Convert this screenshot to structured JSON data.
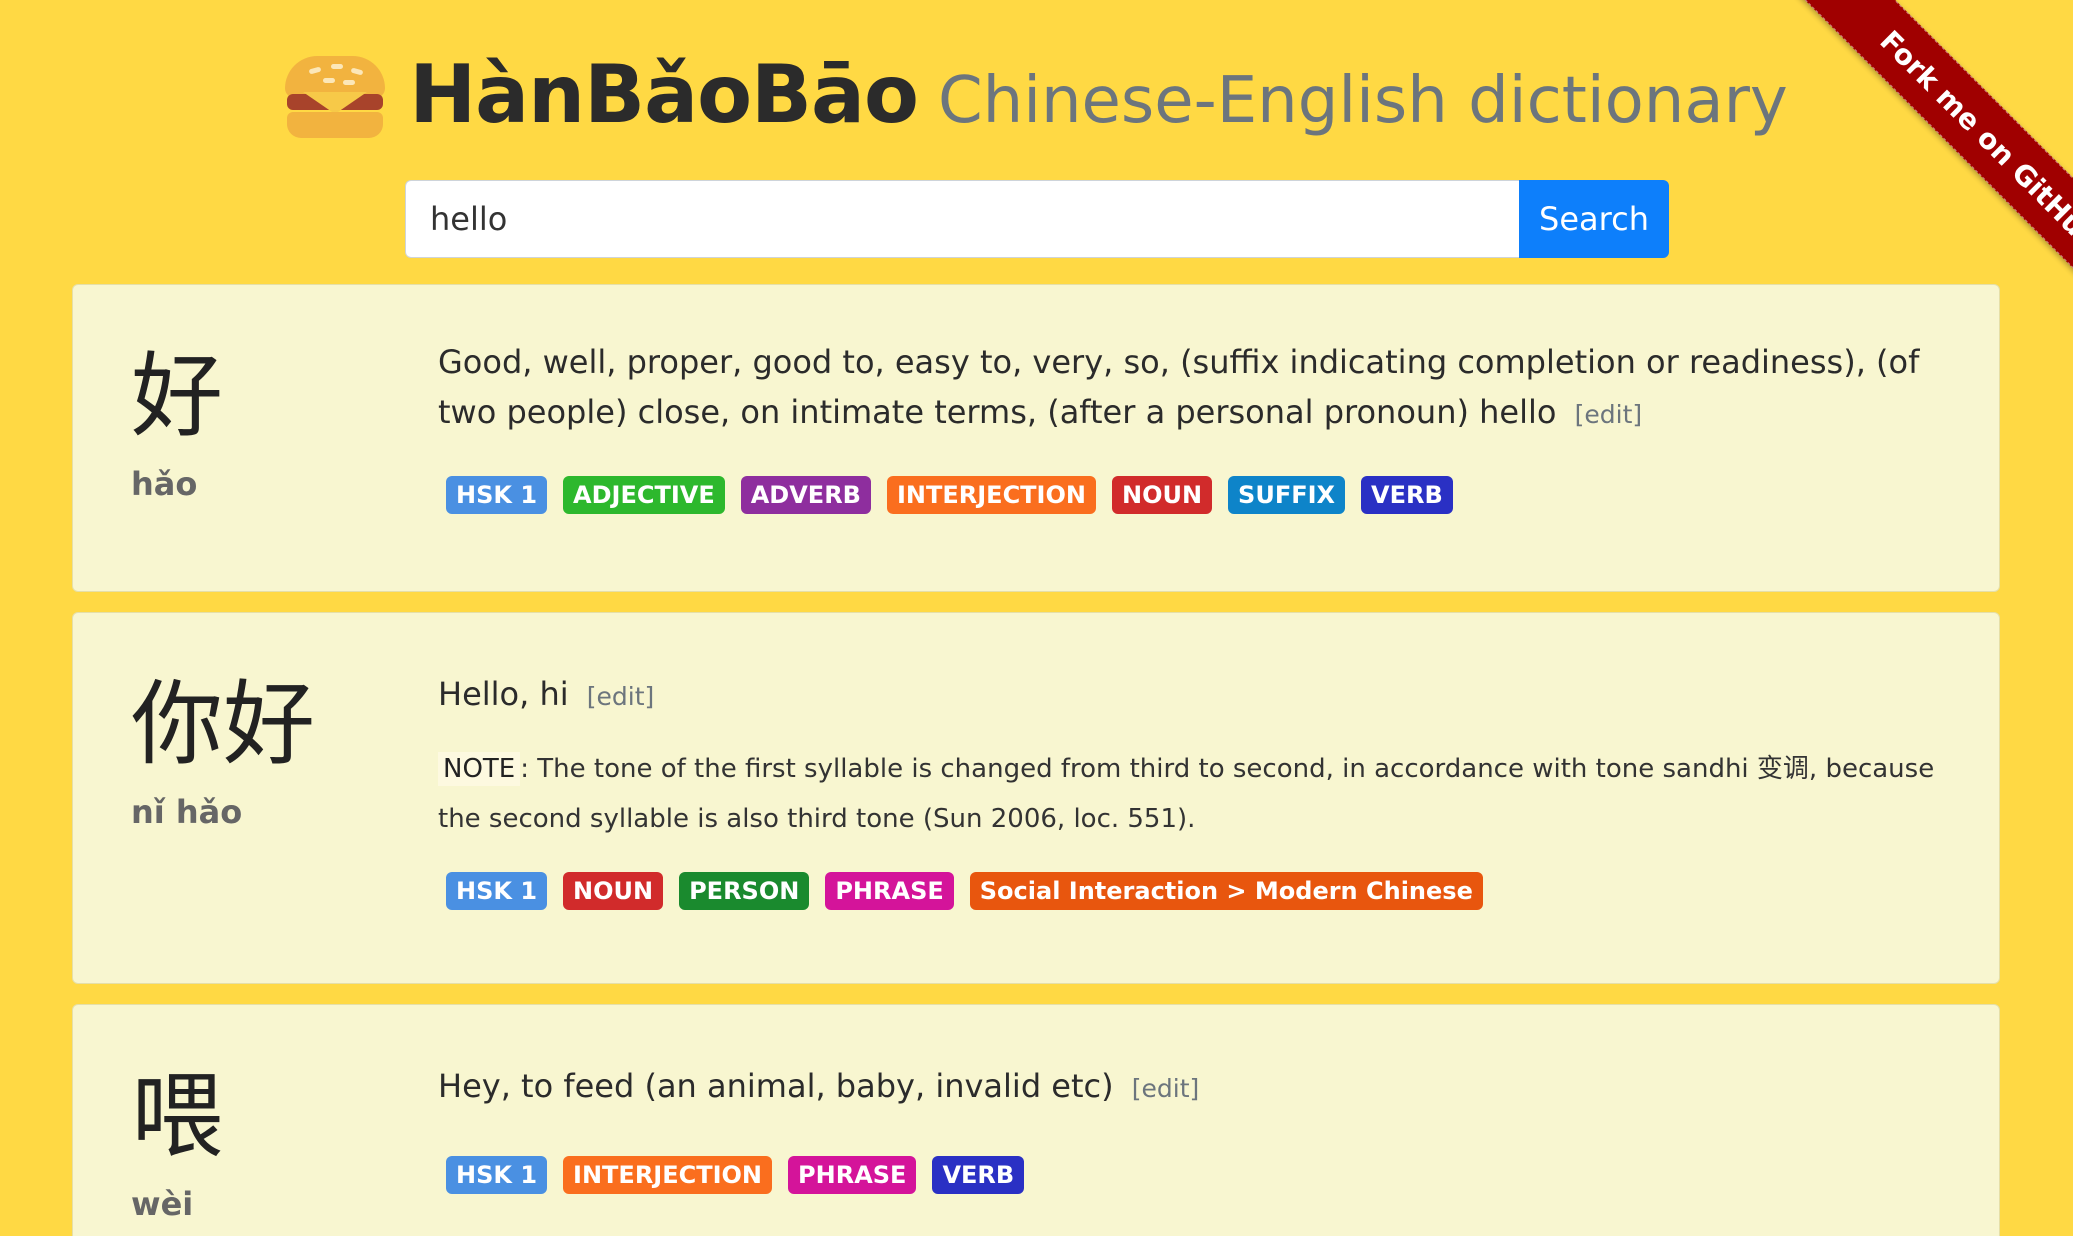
{
  "header": {
    "title": "HànBǎoBāo",
    "subtitle": "Chinese-English dictionary"
  },
  "search": {
    "value": "hello",
    "button_label": "Search"
  },
  "ribbon": {
    "label": "Fork me on GitHub"
  },
  "colors": {
    "page_background": "#FFD944",
    "card_background": "#F8F6D0",
    "search_button": "#0d7ffb",
    "ribbon": "#a00000"
  },
  "entries": [
    {
      "hanzi": "好",
      "pinyin": "hǎo",
      "definition": "Good, well, proper, good to, easy to, very, so, (suffix indicating completion or readiness), (of two people) close, on intimate terms, (after a personal pronoun) hello",
      "edit_label": "[edit]",
      "tags": [
        {
          "label": "HSK 1",
          "color": "#4A90E2"
        },
        {
          "label": "ADJECTIVE",
          "color": "#2DB82D"
        },
        {
          "label": "ADVERB",
          "color": "#8E2E9E"
        },
        {
          "label": "INTERJECTION",
          "color": "#FA6E1E"
        },
        {
          "label": "NOUN",
          "color": "#D12B2B"
        },
        {
          "label": "SUFFIX",
          "color": "#0E84C9"
        },
        {
          "label": "VERB",
          "color": "#2A30C4"
        }
      ]
    },
    {
      "hanzi": "你好",
      "pinyin": "nǐ hǎo",
      "definition": "Hello, hi",
      "edit_label": "[edit]",
      "note_label": "NOTE",
      "note_text": ": The tone of the first syllable is changed from third to second, in accordance with tone sandhi 变调, because the second syllable is also third tone (Sun 2006, loc. 551).",
      "tags": [
        {
          "label": "HSK 1",
          "color": "#4A90E2"
        },
        {
          "label": "NOUN",
          "color": "#D12B2B"
        },
        {
          "label": "PERSON",
          "color": "#1A8A2E"
        },
        {
          "label": "PHRASE",
          "color": "#D4149A"
        },
        {
          "label": "Social Interaction > Modern Chinese",
          "color": "#E8560E"
        }
      ]
    },
    {
      "hanzi": "喂",
      "pinyin": "wèi",
      "definition": "Hey, to feed (an animal, baby, invalid etc)",
      "edit_label": "[edit]",
      "tags": [
        {
          "label": "HSK 1",
          "color": "#4A90E2"
        },
        {
          "label": "INTERJECTION",
          "color": "#FA6E1E"
        },
        {
          "label": "PHRASE",
          "color": "#D4149A"
        },
        {
          "label": "VERB",
          "color": "#2A30C4"
        }
      ]
    }
  ]
}
